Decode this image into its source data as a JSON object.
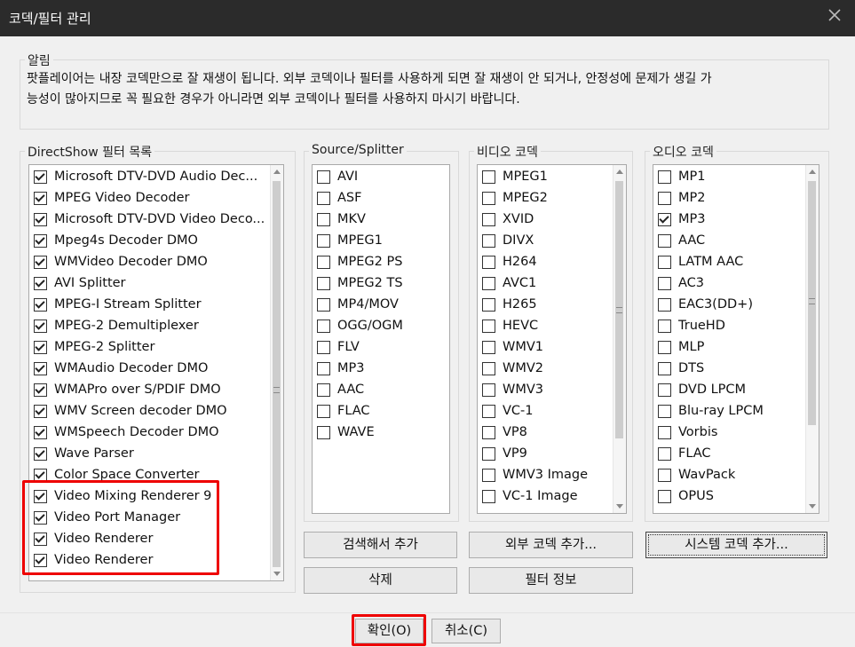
{
  "window": {
    "title": "코덱/필터 관리"
  },
  "notice": {
    "legend": "알림",
    "lines": [
      "팟플레이어는 내장 코덱만으로 잘 재생이 됩니다. 외부 코덱이나 필터를 사용하게 되면 잘 재생이 안 되거나, 안정성에 문제가 생길 가",
      "능성이 많아지므로 꼭 필요한 경우가 아니라면 외부 코덱이나 필터를 사용하지 마시기 바랍니다."
    ]
  },
  "directshow": {
    "legend": "DirectShow 필터 목록",
    "items": [
      {
        "label": "Microsoft DTV-DVD Audio Dec...",
        "checked": true
      },
      {
        "label": "MPEG Video Decoder",
        "checked": true
      },
      {
        "label": "Microsoft DTV-DVD Video Deco...",
        "checked": true
      },
      {
        "label": "Mpeg4s Decoder DMO",
        "checked": true
      },
      {
        "label": "WMVideo Decoder DMO",
        "checked": true
      },
      {
        "label": "AVI Splitter",
        "checked": true
      },
      {
        "label": "MPEG-I Stream Splitter",
        "checked": true
      },
      {
        "label": "MPEG-2 Demultiplexer",
        "checked": true
      },
      {
        "label": "MPEG-2 Splitter",
        "checked": true
      },
      {
        "label": "WMAudio Decoder DMO",
        "checked": true
      },
      {
        "label": "WMAPro over S/PDIF DMO",
        "checked": true
      },
      {
        "label": "WMV Screen decoder DMO",
        "checked": true
      },
      {
        "label": "WMSpeech Decoder DMO",
        "checked": true
      },
      {
        "label": "Wave Parser",
        "checked": true
      },
      {
        "label": "Color Space Converter",
        "checked": true
      },
      {
        "label": "Video Mixing Renderer 9",
        "checked": true
      },
      {
        "label": "Video Port Manager",
        "checked": true
      },
      {
        "label": "Video Renderer",
        "checked": true
      },
      {
        "label": "Video Renderer",
        "checked": true
      }
    ]
  },
  "source": {
    "legend": "Source/Splitter",
    "items": [
      {
        "label": "AVI",
        "checked": false
      },
      {
        "label": "ASF",
        "checked": false
      },
      {
        "label": "MKV",
        "checked": false
      },
      {
        "label": "MPEG1",
        "checked": false
      },
      {
        "label": "MPEG2 PS",
        "checked": false
      },
      {
        "label": "MPEG2 TS",
        "checked": false
      },
      {
        "label": "MP4/MOV",
        "checked": false
      },
      {
        "label": "OGG/OGM",
        "checked": false
      },
      {
        "label": "FLV",
        "checked": false
      },
      {
        "label": "MP3",
        "checked": false
      },
      {
        "label": "AAC",
        "checked": false
      },
      {
        "label": "FLAC",
        "checked": false
      },
      {
        "label": "WAVE",
        "checked": false
      }
    ]
  },
  "video": {
    "legend": "비디오 코덱",
    "items": [
      {
        "label": "MPEG1",
        "checked": false
      },
      {
        "label": "MPEG2",
        "checked": false
      },
      {
        "label": "XVID",
        "checked": false
      },
      {
        "label": "DIVX",
        "checked": false
      },
      {
        "label": "H264",
        "checked": false
      },
      {
        "label": "AVC1",
        "checked": false
      },
      {
        "label": "H265",
        "checked": false
      },
      {
        "label": "HEVC",
        "checked": false
      },
      {
        "label": "WMV1",
        "checked": false
      },
      {
        "label": "WMV2",
        "checked": false
      },
      {
        "label": "WMV3",
        "checked": false
      },
      {
        "label": "VC-1",
        "checked": false
      },
      {
        "label": "VP8",
        "checked": false
      },
      {
        "label": "VP9",
        "checked": false
      },
      {
        "label": "WMV3 Image",
        "checked": false
      },
      {
        "label": "VC-1 Image",
        "checked": false
      }
    ]
  },
  "audio": {
    "legend": "오디오 코덱",
    "items": [
      {
        "label": "MP1",
        "checked": false
      },
      {
        "label": "MP2",
        "checked": false
      },
      {
        "label": "MP3",
        "checked": true
      },
      {
        "label": "AAC",
        "checked": false
      },
      {
        "label": "LATM AAC",
        "checked": false
      },
      {
        "label": "AC3",
        "checked": false
      },
      {
        "label": "EAC3(DD+)",
        "checked": false
      },
      {
        "label": "TrueHD",
        "checked": false
      },
      {
        "label": "MLP",
        "checked": false
      },
      {
        "label": "DTS",
        "checked": false
      },
      {
        "label": "DVD LPCM",
        "checked": false
      },
      {
        "label": "Blu-ray LPCM",
        "checked": false
      },
      {
        "label": "Vorbis",
        "checked": false
      },
      {
        "label": "FLAC",
        "checked": false
      },
      {
        "label": "WavPack",
        "checked": false
      },
      {
        "label": "OPUS",
        "checked": false
      }
    ]
  },
  "buttons": {
    "search_add": "검색해서 추가",
    "delete": "삭제",
    "external_codec_add": "외부 코덱 추가...",
    "filter_info": "필터 정보",
    "system_codec_add": "시스템 코덱 추가...",
    "ok": "확인(O)",
    "cancel": "취소(C)"
  },
  "colors": {
    "highlight": "#e00000",
    "titlebar": "#2b2b2b"
  }
}
